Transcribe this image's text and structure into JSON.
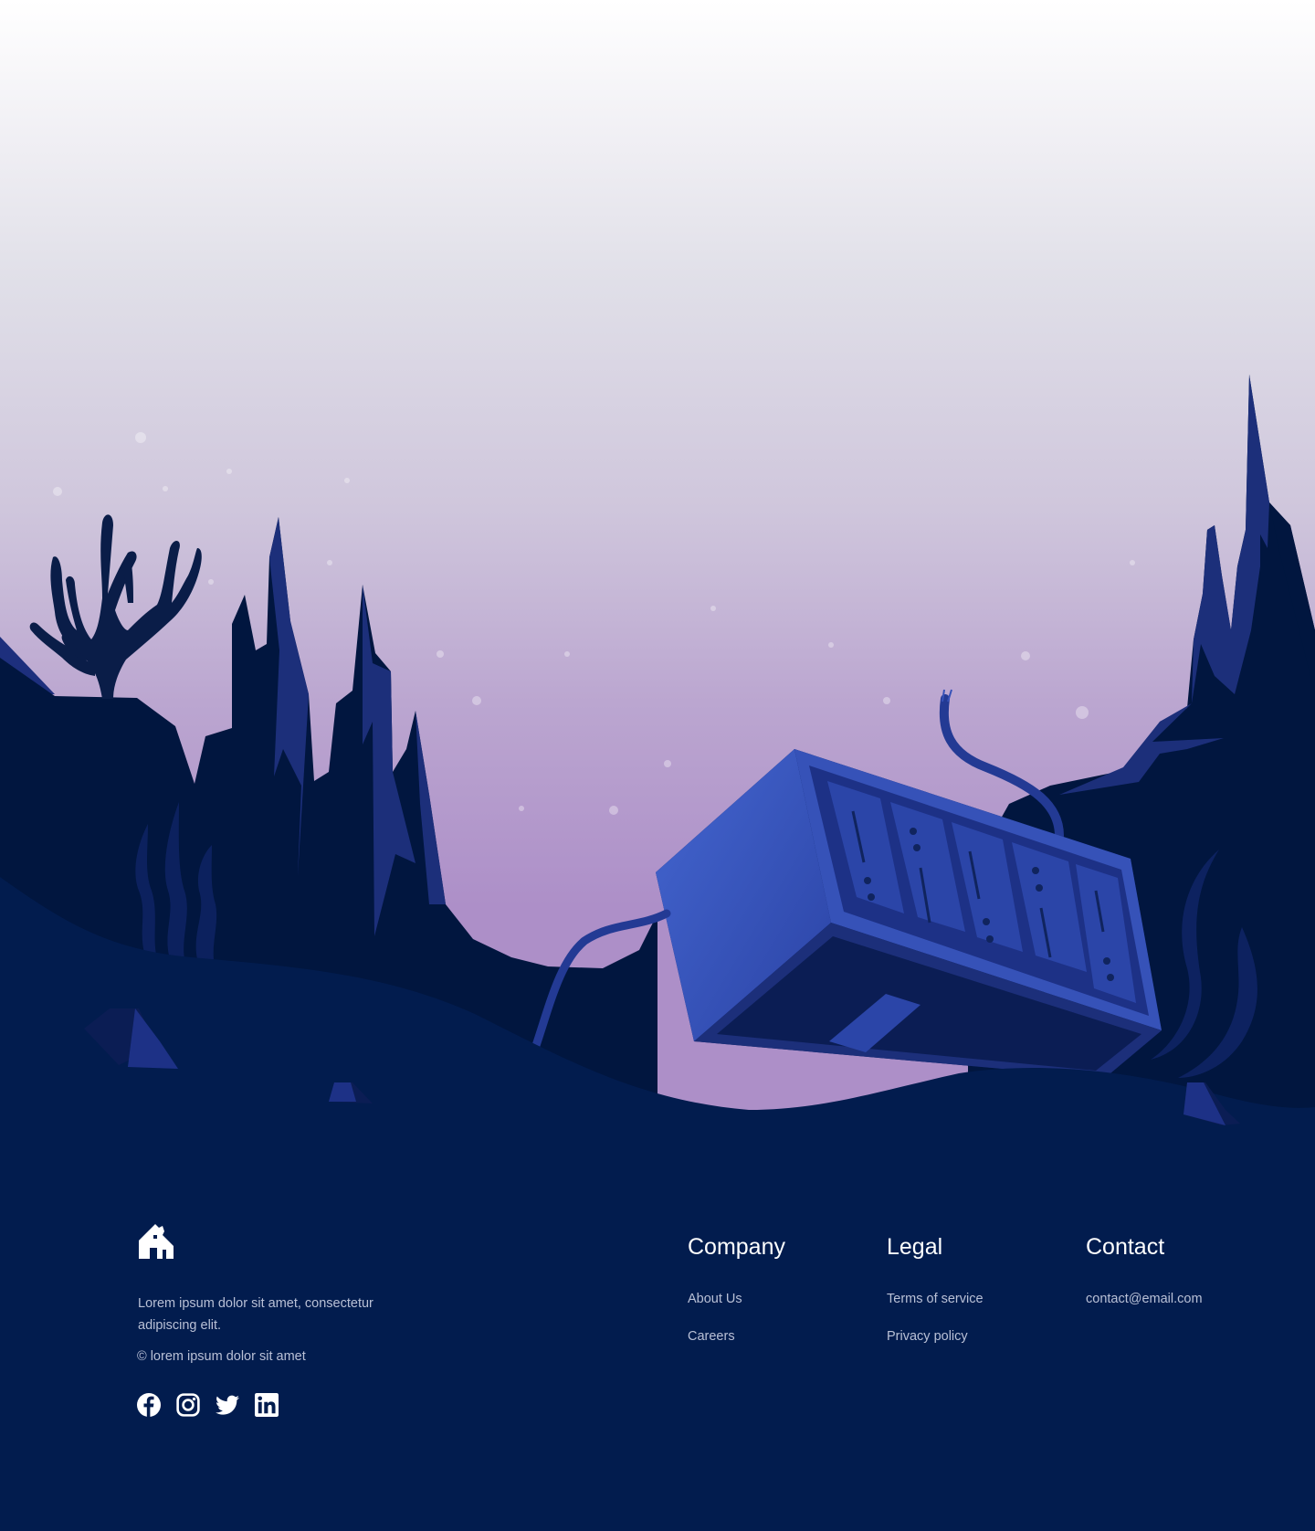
{
  "scene": {
    "description_hidden": ""
  },
  "footer": {
    "brand": {
      "logo_icon": "polar-bear-on-house-logo",
      "description": "Lorem ipsum dolor sit amet, consectetur adipiscing elit.",
      "copyright": "© lorem ipsum dolor sit amet"
    },
    "socials": [
      {
        "icon": "facebook-icon"
      },
      {
        "icon": "instagram-icon"
      },
      {
        "icon": "twitter-icon"
      },
      {
        "icon": "linkedin-icon"
      }
    ],
    "columns": {
      "company": {
        "title": "Company",
        "links": [
          "About Us",
          "Careers"
        ]
      },
      "legal": {
        "title": "Legal",
        "links": [
          "Terms of service",
          "Privacy policy"
        ]
      },
      "contact": {
        "title": "Contact",
        "links": [
          "contact@email.com"
        ]
      }
    }
  },
  "colors": {
    "footer_bg": "#021c4e",
    "deep_navy": "#01163f",
    "accent_blue": "#3652b8",
    "mid_blue": "#1c2f7a",
    "link_text": "#b9c0d6",
    "heading_text": "#ffffff"
  }
}
